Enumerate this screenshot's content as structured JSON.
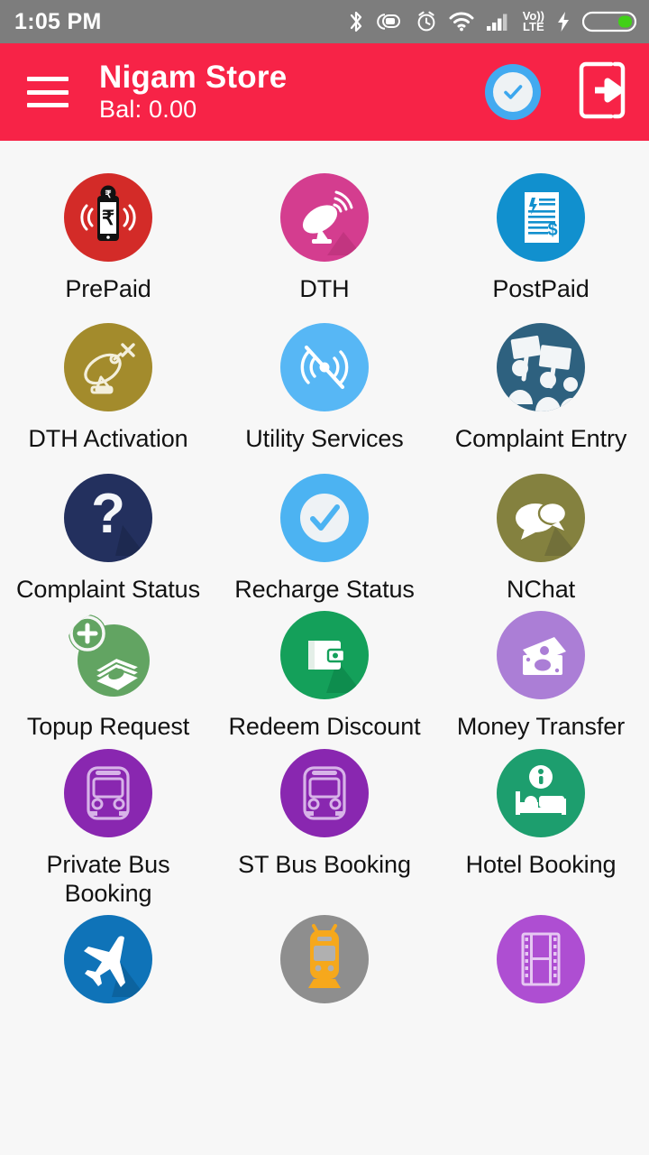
{
  "status_bar": {
    "time": "1:05 PM",
    "icons": [
      {
        "name": "bluetooth-icon"
      },
      {
        "name": "screenshot-icon"
      },
      {
        "name": "alarm-icon"
      },
      {
        "name": "wifi-icon"
      },
      {
        "name": "signal-bars-icon"
      },
      {
        "name": "volte-icon",
        "line1": "Vo))",
        "line2": "LTE"
      },
      {
        "name": "charging-bolt-icon"
      },
      {
        "name": "battery-icon"
      }
    ],
    "background_color": "#7d7d7d",
    "foreground_color": "#ffffff"
  },
  "app_bar": {
    "menu_label": "menu-icon",
    "title": "Nigam Store",
    "balance": "Bal: 0.00",
    "verified_label": "verified-check-icon",
    "logout_label": "logout-icon",
    "background_color": "#f72347"
  },
  "grid": {
    "tiles": [
      {
        "label": "PrePaid",
        "icon": "prepaid-mobile-icon",
        "color": "#d32b28"
      },
      {
        "label": "DTH",
        "icon": "satellite-dish-icon",
        "color": "#d43d8f"
      },
      {
        "label": "PostPaid",
        "icon": "bill-document-icon",
        "color": "#1190ce"
      },
      {
        "label": "DTH Activation",
        "icon": "dish-activation-icon",
        "color": "#a38b2c"
      },
      {
        "label": "Utility Services",
        "icon": "signal-off-icon",
        "color": "#57b7f5"
      },
      {
        "label": "Complaint Entry",
        "icon": "protest-placards-icon",
        "color": "#2e617f"
      },
      {
        "label": "Complaint Status",
        "icon": "question-mark-icon",
        "color": "#23305e"
      },
      {
        "label": "Recharge Status",
        "icon": "check-circle-icon",
        "color": "#4cb3f2"
      },
      {
        "label": "NChat",
        "icon": "chat-bubbles-icon",
        "color": "#84813f"
      },
      {
        "label": "Topup Request",
        "icon": "cash-plus-icon",
        "color": "#62a462"
      },
      {
        "label": "Redeem Discount",
        "icon": "wallet-icon",
        "color": "#14a05a"
      },
      {
        "label": "Money Transfer",
        "icon": "banknotes-icon",
        "color": "#ab7ed6"
      },
      {
        "label": "Private Bus Booking",
        "icon": "bus-icon",
        "color": "#8927b0"
      },
      {
        "label": "ST Bus Booking",
        "icon": "bus-icon",
        "color": "#8927b0"
      },
      {
        "label": "Hotel Booking",
        "icon": "hotel-bed-icon",
        "color": "#1d9e6e"
      },
      {
        "label": "",
        "icon": "airplane-icon",
        "color": "#0f73b8"
      },
      {
        "label": "",
        "icon": "train-icon",
        "color": "#8e8e8e"
      },
      {
        "label": "",
        "icon": "film-strip-icon",
        "color": "#ae4ed2"
      }
    ]
  }
}
